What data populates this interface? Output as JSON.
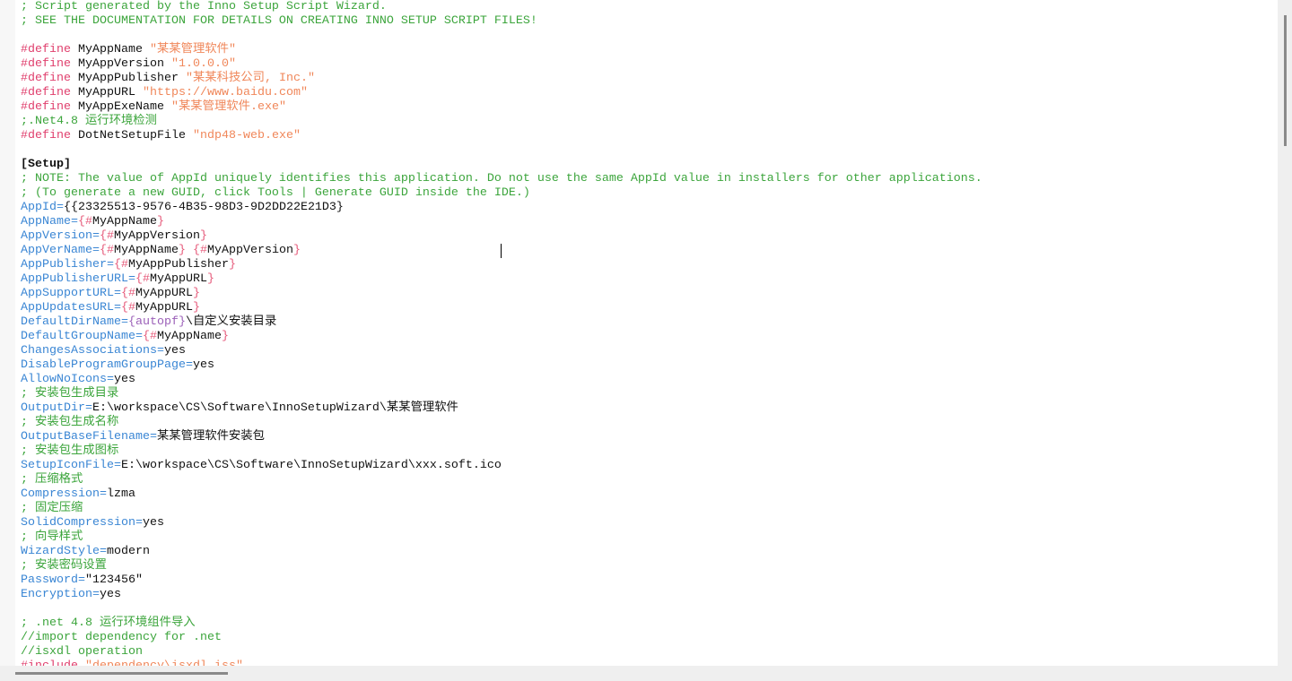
{
  "colors": {
    "comment": "#3ca53c",
    "directive": "#e0406e",
    "string": "#f0875a",
    "key": "#3a86d4",
    "brace": "#e65a7a",
    "constant": "#9b5fb8",
    "text": "#111111"
  },
  "lines": [
    [
      [
        "c",
        "; Script generated by the Inno Setup Script Wizard."
      ]
    ],
    [
      [
        "c",
        "; SEE THE DOCUMENTATION FOR DETAILS ON CREATING INNO SETUP SCRIPT FILES!"
      ]
    ],
    [],
    [
      [
        "d",
        "#define"
      ],
      [
        "t",
        " MyAppName "
      ],
      [
        "s",
        "\"某某管理软件\""
      ]
    ],
    [
      [
        "d",
        "#define"
      ],
      [
        "t",
        " MyAppVersion "
      ],
      [
        "s",
        "\"1.0.0.0\""
      ]
    ],
    [
      [
        "d",
        "#define"
      ],
      [
        "t",
        " MyAppPublisher "
      ],
      [
        "s",
        "\"某某科技公司, Inc.\""
      ]
    ],
    [
      [
        "d",
        "#define"
      ],
      [
        "t",
        " MyAppURL "
      ],
      [
        "s",
        "\"https://www.baidu.com\""
      ]
    ],
    [
      [
        "d",
        "#define"
      ],
      [
        "t",
        " MyAppExeName "
      ],
      [
        "s",
        "\"某某管理软件.exe\""
      ]
    ],
    [
      [
        "c",
        ";.Net4.8 运行环境检测"
      ]
    ],
    [
      [
        "d",
        "#define"
      ],
      [
        "t",
        " DotNetSetupFile "
      ],
      [
        "s",
        "\"ndp48-web.exe\""
      ]
    ],
    [],
    [
      [
        "h",
        "[Setup]"
      ]
    ],
    [
      [
        "c",
        "; NOTE: The value of AppId uniquely identifies this application. Do not use the same AppId value in installers for other applications."
      ]
    ],
    [
      [
        "c",
        "; (To generate a new GUID, click Tools | Generate GUID inside the IDE.)"
      ]
    ],
    [
      [
        "k",
        "AppId="
      ],
      [
        "t",
        "{{23325513-9576-4B35-98D3-9D2DD22E21D3}"
      ]
    ],
    [
      [
        "k",
        "AppName="
      ],
      [
        "b",
        "{#"
      ],
      [
        "t",
        "MyAppName"
      ],
      [
        "b",
        "}"
      ]
    ],
    [
      [
        "k",
        "AppVersion="
      ],
      [
        "b",
        "{#"
      ],
      [
        "t",
        "MyAppVersion"
      ],
      [
        "b",
        "}"
      ]
    ],
    [
      [
        "k",
        "AppVerName="
      ],
      [
        "b",
        "{#"
      ],
      [
        "t",
        "MyAppName"
      ],
      [
        "b",
        "}"
      ],
      [
        "t",
        " "
      ],
      [
        "b",
        "{#"
      ],
      [
        "t",
        "MyAppVersion"
      ],
      [
        "b",
        "}"
      ]
    ],
    [
      [
        "k",
        "AppPublisher="
      ],
      [
        "b",
        "{#"
      ],
      [
        "t",
        "MyAppPublisher"
      ],
      [
        "b",
        "}"
      ]
    ],
    [
      [
        "k",
        "AppPublisherURL="
      ],
      [
        "b",
        "{#"
      ],
      [
        "t",
        "MyAppURL"
      ],
      [
        "b",
        "}"
      ]
    ],
    [
      [
        "k",
        "AppSupportURL="
      ],
      [
        "b",
        "{#"
      ],
      [
        "t",
        "MyAppURL"
      ],
      [
        "b",
        "}"
      ]
    ],
    [
      [
        "k",
        "AppUpdatesURL="
      ],
      [
        "b",
        "{#"
      ],
      [
        "t",
        "MyAppURL"
      ],
      [
        "b",
        "}"
      ]
    ],
    [
      [
        "k",
        "DefaultDirName="
      ],
      [
        "p",
        "{autopf}"
      ],
      [
        "t",
        "\\自定义安装目录"
      ]
    ],
    [
      [
        "k",
        "DefaultGroupName="
      ],
      [
        "b",
        "{#"
      ],
      [
        "t",
        "MyAppName"
      ],
      [
        "b",
        "}"
      ]
    ],
    [
      [
        "k",
        "ChangesAssociations="
      ],
      [
        "t",
        "yes"
      ]
    ],
    [
      [
        "k",
        "DisableProgramGroupPage="
      ],
      [
        "t",
        "yes"
      ]
    ],
    [
      [
        "k",
        "AllowNoIcons="
      ],
      [
        "t",
        "yes"
      ]
    ],
    [
      [
        "c",
        "; 安装包生成目录"
      ]
    ],
    [
      [
        "k",
        "OutputDir="
      ],
      [
        "t",
        "E:\\workspace\\CS\\Software\\InnoSetupWizard\\某某管理软件"
      ]
    ],
    [
      [
        "c",
        "; 安装包生成名称"
      ]
    ],
    [
      [
        "k",
        "OutputBaseFilename="
      ],
      [
        "t",
        "某某管理软件安装包"
      ]
    ],
    [
      [
        "c",
        "; 安装包生成图标"
      ]
    ],
    [
      [
        "k",
        "SetupIconFile="
      ],
      [
        "t",
        "E:\\workspace\\CS\\Software\\InnoSetupWizard\\xxx.soft.ico"
      ]
    ],
    [
      [
        "c",
        "; 压缩格式"
      ]
    ],
    [
      [
        "k",
        "Compression="
      ],
      [
        "t",
        "lzma"
      ]
    ],
    [
      [
        "c",
        "; 固定压缩"
      ]
    ],
    [
      [
        "k",
        "SolidCompression="
      ],
      [
        "t",
        "yes"
      ]
    ],
    [
      [
        "c",
        "; 向导样式"
      ]
    ],
    [
      [
        "k",
        "WizardStyle="
      ],
      [
        "t",
        "modern"
      ]
    ],
    [
      [
        "c",
        "; 安装密码设置"
      ]
    ],
    [
      [
        "k",
        "Password="
      ],
      [
        "t",
        "\"123456\""
      ]
    ],
    [
      [
        "k",
        "Encryption="
      ],
      [
        "t",
        "yes"
      ]
    ],
    [],
    [
      [
        "c",
        "; .net 4.8 运行环境组件导入"
      ]
    ],
    [
      [
        "c",
        "//import dependency for .net"
      ]
    ],
    [
      [
        "c",
        "//isxdl operation"
      ]
    ],
    [
      [
        "d",
        "#include "
      ],
      [
        "s",
        "\"dependency\\isxdl.iss\""
      ]
    ]
  ]
}
